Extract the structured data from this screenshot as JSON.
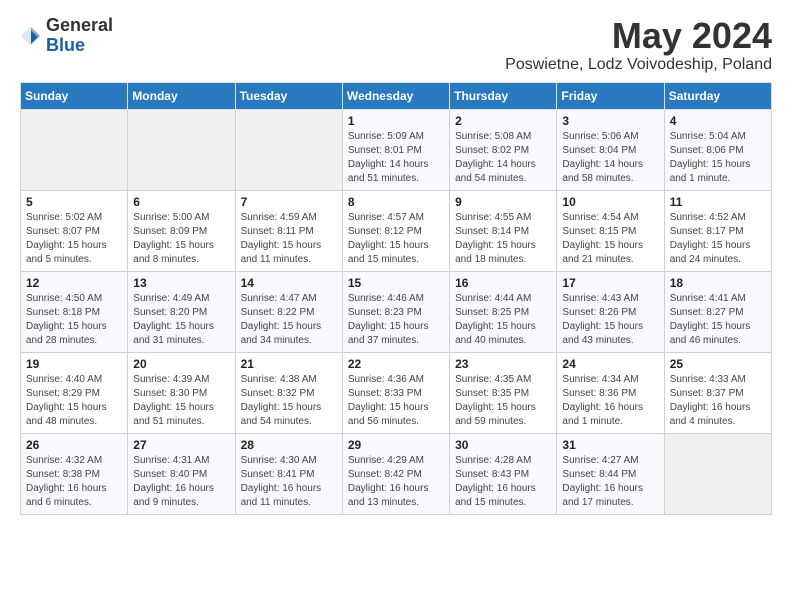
{
  "header": {
    "logo_general": "General",
    "logo_blue": "Blue",
    "month": "May 2024",
    "location": "Poswietne, Lodz Voivodeship, Poland"
  },
  "days_of_week": [
    "Sunday",
    "Monday",
    "Tuesday",
    "Wednesday",
    "Thursday",
    "Friday",
    "Saturday"
  ],
  "weeks": [
    [
      {
        "day": "",
        "sunrise": "",
        "sunset": "",
        "daylight": ""
      },
      {
        "day": "",
        "sunrise": "",
        "sunset": "",
        "daylight": ""
      },
      {
        "day": "",
        "sunrise": "",
        "sunset": "",
        "daylight": ""
      },
      {
        "day": "1",
        "sunrise": "Sunrise: 5:09 AM",
        "sunset": "Sunset: 8:01 PM",
        "daylight": "Daylight: 14 hours and 51 minutes."
      },
      {
        "day": "2",
        "sunrise": "Sunrise: 5:08 AM",
        "sunset": "Sunset: 8:02 PM",
        "daylight": "Daylight: 14 hours and 54 minutes."
      },
      {
        "day": "3",
        "sunrise": "Sunrise: 5:06 AM",
        "sunset": "Sunset: 8:04 PM",
        "daylight": "Daylight: 14 hours and 58 minutes."
      },
      {
        "day": "4",
        "sunrise": "Sunrise: 5:04 AM",
        "sunset": "Sunset: 8:06 PM",
        "daylight": "Daylight: 15 hours and 1 minute."
      }
    ],
    [
      {
        "day": "5",
        "sunrise": "Sunrise: 5:02 AM",
        "sunset": "Sunset: 8:07 PM",
        "daylight": "Daylight: 15 hours and 5 minutes."
      },
      {
        "day": "6",
        "sunrise": "Sunrise: 5:00 AM",
        "sunset": "Sunset: 8:09 PM",
        "daylight": "Daylight: 15 hours and 8 minutes."
      },
      {
        "day": "7",
        "sunrise": "Sunrise: 4:59 AM",
        "sunset": "Sunset: 8:11 PM",
        "daylight": "Daylight: 15 hours and 11 minutes."
      },
      {
        "day": "8",
        "sunrise": "Sunrise: 4:57 AM",
        "sunset": "Sunset: 8:12 PM",
        "daylight": "Daylight: 15 hours and 15 minutes."
      },
      {
        "day": "9",
        "sunrise": "Sunrise: 4:55 AM",
        "sunset": "Sunset: 8:14 PM",
        "daylight": "Daylight: 15 hours and 18 minutes."
      },
      {
        "day": "10",
        "sunrise": "Sunrise: 4:54 AM",
        "sunset": "Sunset: 8:15 PM",
        "daylight": "Daylight: 15 hours and 21 minutes."
      },
      {
        "day": "11",
        "sunrise": "Sunrise: 4:52 AM",
        "sunset": "Sunset: 8:17 PM",
        "daylight": "Daylight: 15 hours and 24 minutes."
      }
    ],
    [
      {
        "day": "12",
        "sunrise": "Sunrise: 4:50 AM",
        "sunset": "Sunset: 8:18 PM",
        "daylight": "Daylight: 15 hours and 28 minutes."
      },
      {
        "day": "13",
        "sunrise": "Sunrise: 4:49 AM",
        "sunset": "Sunset: 8:20 PM",
        "daylight": "Daylight: 15 hours and 31 minutes."
      },
      {
        "day": "14",
        "sunrise": "Sunrise: 4:47 AM",
        "sunset": "Sunset: 8:22 PM",
        "daylight": "Daylight: 15 hours and 34 minutes."
      },
      {
        "day": "15",
        "sunrise": "Sunrise: 4:46 AM",
        "sunset": "Sunset: 8:23 PM",
        "daylight": "Daylight: 15 hours and 37 minutes."
      },
      {
        "day": "16",
        "sunrise": "Sunrise: 4:44 AM",
        "sunset": "Sunset: 8:25 PM",
        "daylight": "Daylight: 15 hours and 40 minutes."
      },
      {
        "day": "17",
        "sunrise": "Sunrise: 4:43 AM",
        "sunset": "Sunset: 8:26 PM",
        "daylight": "Daylight: 15 hours and 43 minutes."
      },
      {
        "day": "18",
        "sunrise": "Sunrise: 4:41 AM",
        "sunset": "Sunset: 8:27 PM",
        "daylight": "Daylight: 15 hours and 46 minutes."
      }
    ],
    [
      {
        "day": "19",
        "sunrise": "Sunrise: 4:40 AM",
        "sunset": "Sunset: 8:29 PM",
        "daylight": "Daylight: 15 hours and 48 minutes."
      },
      {
        "day": "20",
        "sunrise": "Sunrise: 4:39 AM",
        "sunset": "Sunset: 8:30 PM",
        "daylight": "Daylight: 15 hours and 51 minutes."
      },
      {
        "day": "21",
        "sunrise": "Sunrise: 4:38 AM",
        "sunset": "Sunset: 8:32 PM",
        "daylight": "Daylight: 15 hours and 54 minutes."
      },
      {
        "day": "22",
        "sunrise": "Sunrise: 4:36 AM",
        "sunset": "Sunset: 8:33 PM",
        "daylight": "Daylight: 15 hours and 56 minutes."
      },
      {
        "day": "23",
        "sunrise": "Sunrise: 4:35 AM",
        "sunset": "Sunset: 8:35 PM",
        "daylight": "Daylight: 15 hours and 59 minutes."
      },
      {
        "day": "24",
        "sunrise": "Sunrise: 4:34 AM",
        "sunset": "Sunset: 8:36 PM",
        "daylight": "Daylight: 16 hours and 1 minute."
      },
      {
        "day": "25",
        "sunrise": "Sunrise: 4:33 AM",
        "sunset": "Sunset: 8:37 PM",
        "daylight": "Daylight: 16 hours and 4 minutes."
      }
    ],
    [
      {
        "day": "26",
        "sunrise": "Sunrise: 4:32 AM",
        "sunset": "Sunset: 8:38 PM",
        "daylight": "Daylight: 16 hours and 6 minutes."
      },
      {
        "day": "27",
        "sunrise": "Sunrise: 4:31 AM",
        "sunset": "Sunset: 8:40 PM",
        "daylight": "Daylight: 16 hours and 9 minutes."
      },
      {
        "day": "28",
        "sunrise": "Sunrise: 4:30 AM",
        "sunset": "Sunset: 8:41 PM",
        "daylight": "Daylight: 16 hours and 11 minutes."
      },
      {
        "day": "29",
        "sunrise": "Sunrise: 4:29 AM",
        "sunset": "Sunset: 8:42 PM",
        "daylight": "Daylight: 16 hours and 13 minutes."
      },
      {
        "day": "30",
        "sunrise": "Sunrise: 4:28 AM",
        "sunset": "Sunset: 8:43 PM",
        "daylight": "Daylight: 16 hours and 15 minutes."
      },
      {
        "day": "31",
        "sunrise": "Sunrise: 4:27 AM",
        "sunset": "Sunset: 8:44 PM",
        "daylight": "Daylight: 16 hours and 17 minutes."
      },
      {
        "day": "",
        "sunrise": "",
        "sunset": "",
        "daylight": ""
      }
    ]
  ]
}
